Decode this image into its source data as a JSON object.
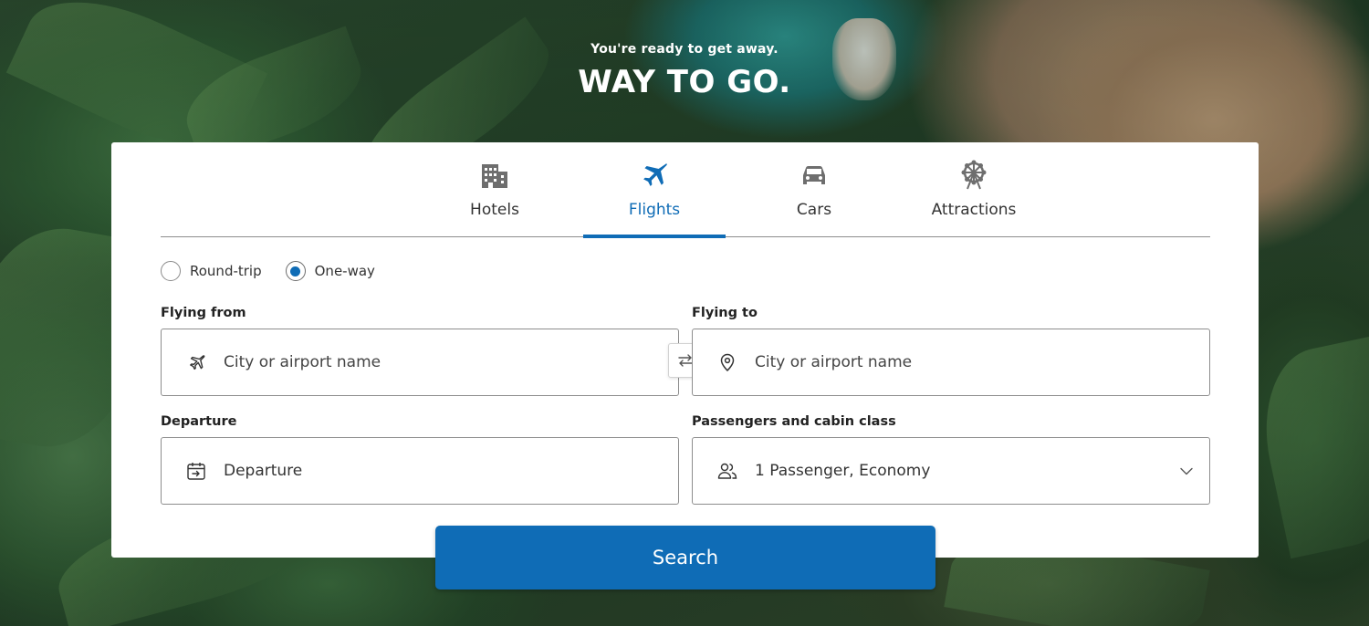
{
  "hero": {
    "subtitle": "You're ready to get away.",
    "title": "WAY TO GO."
  },
  "tabs": [
    {
      "label": "Hotels",
      "icon": "hotel-icon",
      "active": false
    },
    {
      "label": "Flights",
      "icon": "airplane-icon",
      "active": true
    },
    {
      "label": "Cars",
      "icon": "car-icon",
      "active": false
    },
    {
      "label": "Attractions",
      "icon": "ferris-wheel-icon",
      "active": false
    }
  ],
  "trip_type": {
    "options": [
      "Round-trip",
      "One-way"
    ],
    "selected": "One-way"
  },
  "form": {
    "from_label": "Flying from",
    "from_placeholder": "City or airport name",
    "to_label": "Flying to",
    "to_placeholder": "City or airport name",
    "departure_label": "Departure",
    "departure_value": "Departure",
    "passengers_label": "Passengers and cabin class",
    "passengers_value": "1 Passenger, Economy"
  },
  "search_label": "Search",
  "colors": {
    "accent": "#0f6cb6",
    "text": "#333333",
    "border": "#8d8d8d"
  }
}
